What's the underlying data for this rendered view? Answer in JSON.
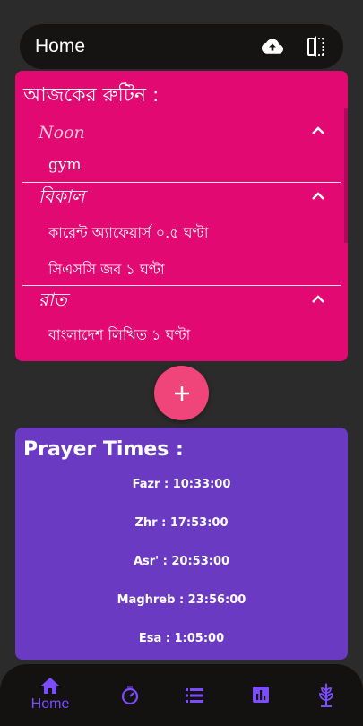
{
  "topbar": {
    "title": "Home",
    "icons": [
      "cloud-upload-icon",
      "compare-icon"
    ]
  },
  "routine": {
    "heading": "আজকের রুটিন :",
    "sections": [
      {
        "title": "Noon",
        "items": [
          "gym"
        ]
      },
      {
        "title": "বিকাল",
        "items": [
          "কারেন্ট অ্যাফেয়ার্স ০.৫ ঘণ্টা",
          "সিএসসি জব ১ ঘণ্টা"
        ]
      },
      {
        "title": "রাত",
        "items": [
          "বাংলাদেশ লিখিত ১ ঘণ্টা"
        ]
      }
    ]
  },
  "fab": {
    "icon": "plus-icon"
  },
  "prayer": {
    "heading": "Prayer Times :",
    "times": [
      "Fazr : 10:33:00",
      "Zhr : 17:53:00",
      "Asr' : 20:53:00",
      "Maghreb : 23:56:00",
      "Esa : 1:05:00"
    ]
  },
  "bottomnav": {
    "items": [
      {
        "label": "Home",
        "icon": "home-icon",
        "active": true
      },
      {
        "label": "",
        "icon": "timer-icon"
      },
      {
        "label": "",
        "icon": "list-icon"
      },
      {
        "label": "",
        "icon": "bar-chart-icon"
      },
      {
        "label": "",
        "icon": "plant-icon"
      }
    ]
  },
  "colors": {
    "background": "#2b2b2b",
    "routine_card": "#e20a72",
    "prayer_card": "#6a3ac2",
    "fab": "#f0457b",
    "nav_accent": "#7c4dff"
  }
}
